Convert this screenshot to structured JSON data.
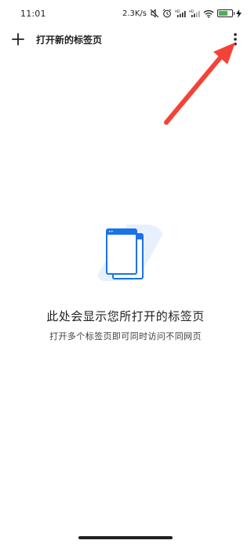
{
  "status_bar": {
    "time": "11:01",
    "network_speed": "2.3K/s",
    "signal_label_1": "HD",
    "signal_label_2": "HD",
    "battery_level": "69",
    "icons": [
      "mute-icon",
      "alarm-icon",
      "signal-icon",
      "signal-icon",
      "wifi-icon",
      "battery-icon",
      "charging-icon"
    ]
  },
  "toolbar": {
    "new_tab_icon": "plus-icon",
    "title": "打开新的标签页",
    "menu_icon": "more-vert-icon"
  },
  "empty_state": {
    "illustration": "tabs-illustration",
    "title": "此处会显示您所打开的标签页",
    "subtitle": "打开多个标签页即可同时访问不同网页"
  },
  "colors": {
    "accent_blue": "#1a73e8",
    "illustration_bg": "#e8f0fe",
    "arrow_red": "#f44336"
  }
}
